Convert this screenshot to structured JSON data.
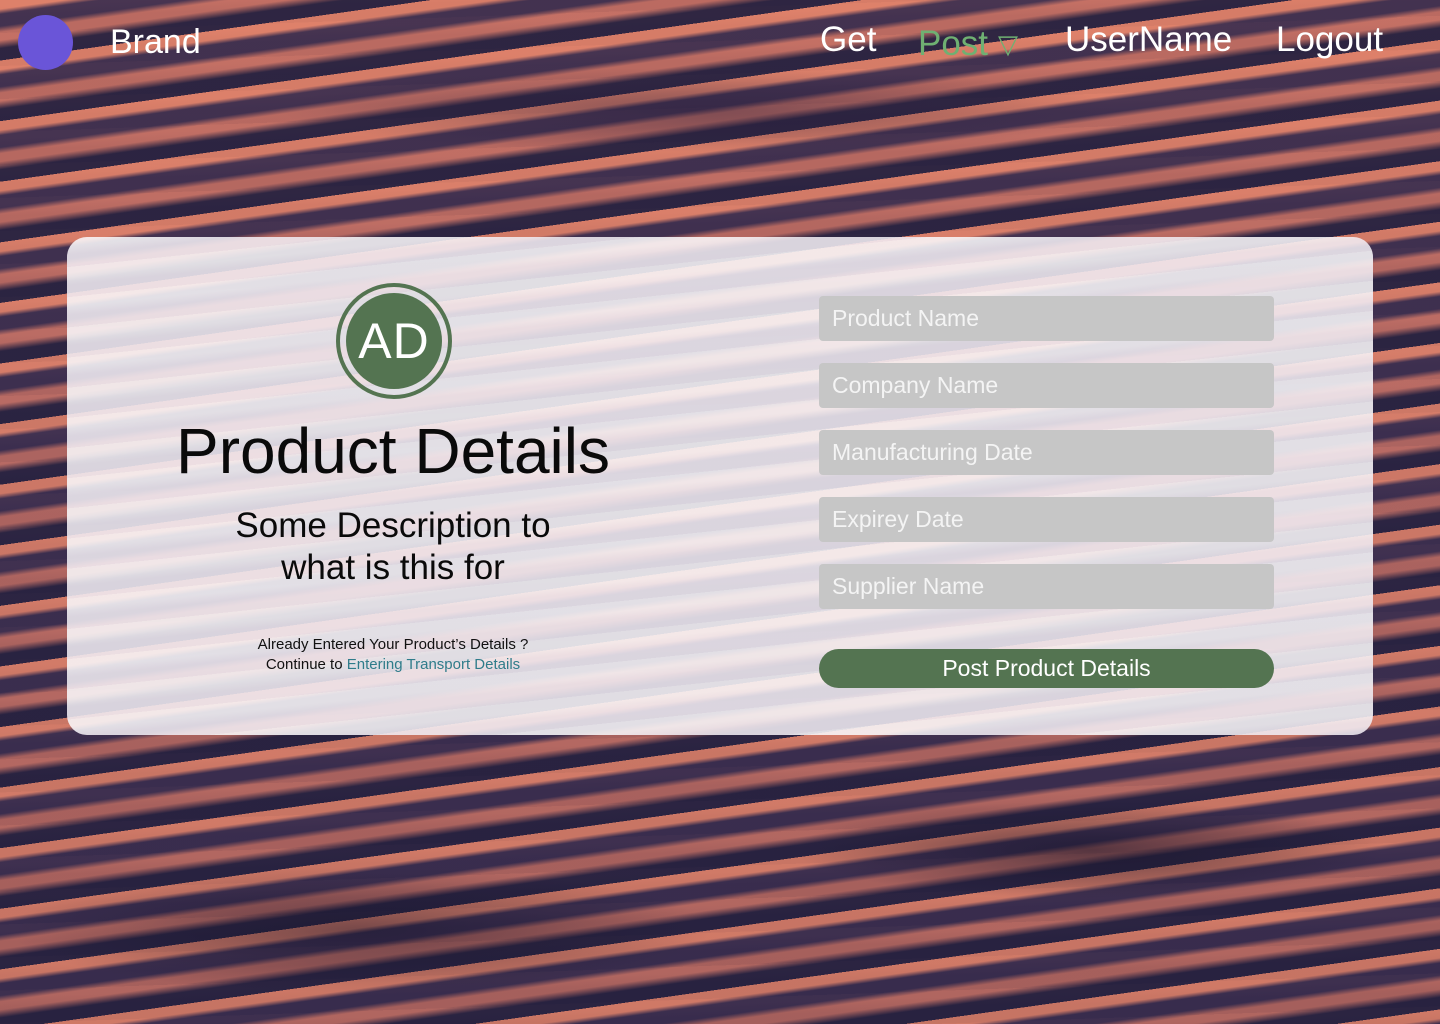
{
  "nav": {
    "brand": "Brand",
    "links": {
      "get": "Get",
      "post": "Post",
      "post_chevron": "▽",
      "username": "UserName",
      "logout": "Logout"
    },
    "active_color": "#6fb072",
    "brand_logo_color": "#6a55d8"
  },
  "card": {
    "avatar_initials": "AD",
    "title": "Product Details",
    "description": "Some Description to\nwhat is this  for",
    "already_line": "Already Entered Your Product’s Details ?",
    "continue_prefix": "Continue to ",
    "continue_link": "Entering Transport Details",
    "accent_color": "#547451",
    "link_color": "#2f7c8a"
  },
  "form": {
    "fields": [
      {
        "placeholder": "Product Name",
        "value": ""
      },
      {
        "placeholder": "Company Name",
        "value": ""
      },
      {
        "placeholder": "Manufacturing Date",
        "value": ""
      },
      {
        "placeholder": "Expirey Date",
        "value": ""
      },
      {
        "placeholder": "Supplier Name",
        "value": ""
      }
    ],
    "submit_label": "Post Product Details"
  }
}
